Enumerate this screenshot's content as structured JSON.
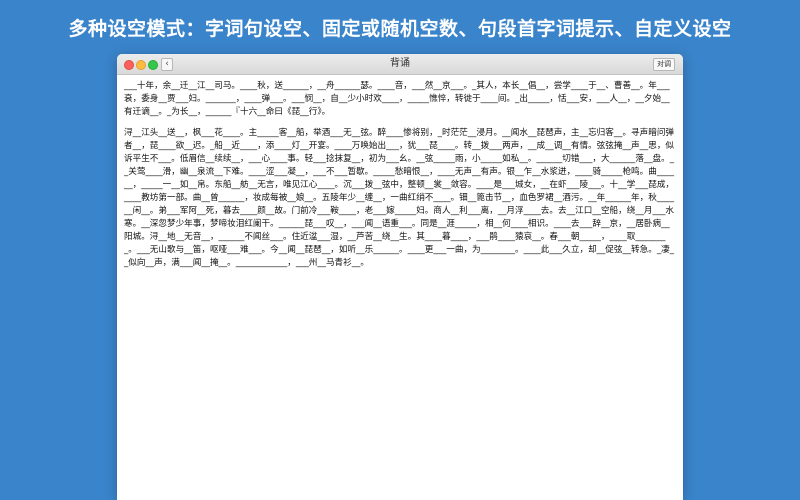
{
  "headline": "多种设空模式：字词句设空、固定或随机空数、句段首字词提示、自定义设空",
  "window": {
    "title": "背诵",
    "back_label": "‹",
    "toggle_label": "对调"
  },
  "paragraphs": [
    "___十年，余__迁__江__司马。____秋，送______，__舟______瑟。____音，___然__京___。_其人，本长__倡__，尝学____于__、曹善__。年___衰，委身__贾___妇。_______，____弹___。___悯__，自__少小时欢____，_____憔悴，转徙于____间。_出_____，恬___安，___人__，__夕始__有迁谪__。_为长__，______『十六__命曰《琵__行》。",
    "浔__江头__送__，枫___花____。主_____客__船，举酒___无__弦。醉____惨将别，_时茫茫__浸月。__闻水__琵琶声，主__忘归客__。寻声暗问弹者__，琵____欲__迟。_船__近____，添____灯__开宴。____万唤始出___，犹___琵____。转__拨___两声，__成__调__有情。弦弦掩__声__思，似诉平生不___。低眉信__续续__，___心____事。轻___捻抹复__，初为___幺。__弦_____雨，小_____如私__。______切错___，大______落__盘。__关莺____滑，幽__泉流__下难。____涩___凝__，___不___暂歇。_____愁暗恨__，____无声__有声。银__乍__水浆迸，____骑_____枪鸣。曲______，_____一__如__帛。东船__舫__无言，唯见江心____。沉___拨__弦中，整顿__裳__敛容。____是___城女，__在虾___陵___。十__学___琵成，____教坊第一部。曲__曾______，妆成每被__娘__。五陵年少__缠__，一曲红绡不____。钿__篦击节__，血色罗裙__酒污。__年______年，秋______闲__。弟___军阿__死，暮去____颜__故。门前冷___鞍____，老___嫁_____妇。商人__利___离，__月浮____去。去__江口__空船，绕__月___水寒。__深忽梦少年事，梦啼妆泪红阑干。______琵___叹__，___闻__语重___。同是__涯_____，相__何____相识。____去___辞__京，__居卧病__阳城。浔__地__无音__，______不闻丝___。住近湓___湿，__芦苦__绕__生。其____暮____，___鹃____猿哀__。春___朝_____，____取________。___无山歌与__笛，呕哑___难___。今__闻__琵琶__，如听__乐______。____更___一曲，为________。____此___久立，却__促弦__转急。_凄__似向__声，满___闻__掩__。____________，___州__马青衫__。"
  ]
}
